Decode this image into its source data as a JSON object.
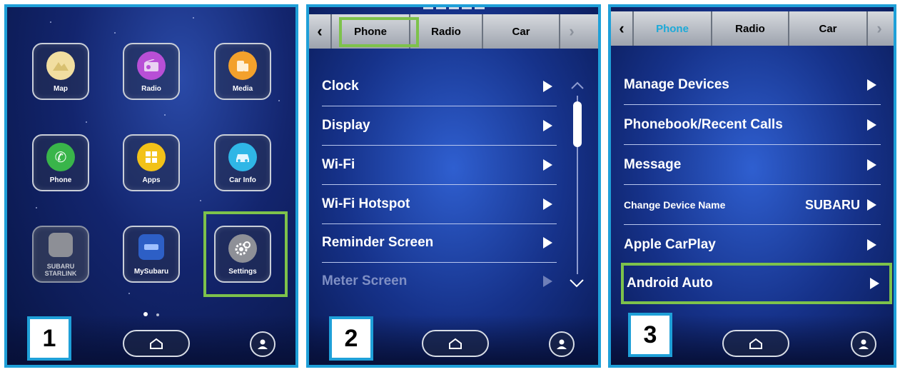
{
  "colors": {
    "accent_border": "#1fa0d8",
    "highlight": "#7dc24b",
    "active_tab": "#1ca9d8"
  },
  "panel1": {
    "number": "1",
    "apps": [
      {
        "label": "Map",
        "icon": "map-icon",
        "color": "#f1dea0"
      },
      {
        "label": "Radio",
        "icon": "radio-icon",
        "color": "#b84fd6"
      },
      {
        "label": "Media",
        "icon": "media-icon",
        "color": "#f3a12c"
      },
      {
        "label": "Phone",
        "icon": "phone-icon",
        "color": "#39b54a"
      },
      {
        "label": "Apps",
        "icon": "apps-icon",
        "color": "#f2c219"
      },
      {
        "label": "Car Info",
        "icon": "car-info-icon",
        "color": "#2fb6e6"
      },
      {
        "label": "SUBARU STARLINK",
        "icon": "starlink-icon",
        "color": "#8d8f96"
      },
      {
        "label": "MySubaru",
        "icon": "mysubaru-icon",
        "color": "#2d5fc6"
      },
      {
        "label": "Settings",
        "icon": "gear-icon",
        "color": "#8e9097"
      }
    ]
  },
  "panel2": {
    "number": "2",
    "tabs": [
      "Phone",
      "Radio",
      "Car"
    ],
    "rows": [
      "Clock",
      "Display",
      "Wi-Fi",
      "Wi-Fi Hotspot",
      "Reminder Screen",
      "Meter Screen"
    ]
  },
  "panel3": {
    "number": "3",
    "tabs": [
      "Phone",
      "Radio",
      "Car"
    ],
    "rows": [
      {
        "label": "Manage Devices",
        "value": ""
      },
      {
        "label": "Phonebook/Recent Calls",
        "value": ""
      },
      {
        "label": "Message",
        "value": ""
      },
      {
        "label": "Change Device Name",
        "value": "SUBARU"
      },
      {
        "label": "Apple CarPlay",
        "value": ""
      },
      {
        "label": "Android Auto",
        "value": ""
      }
    ]
  }
}
